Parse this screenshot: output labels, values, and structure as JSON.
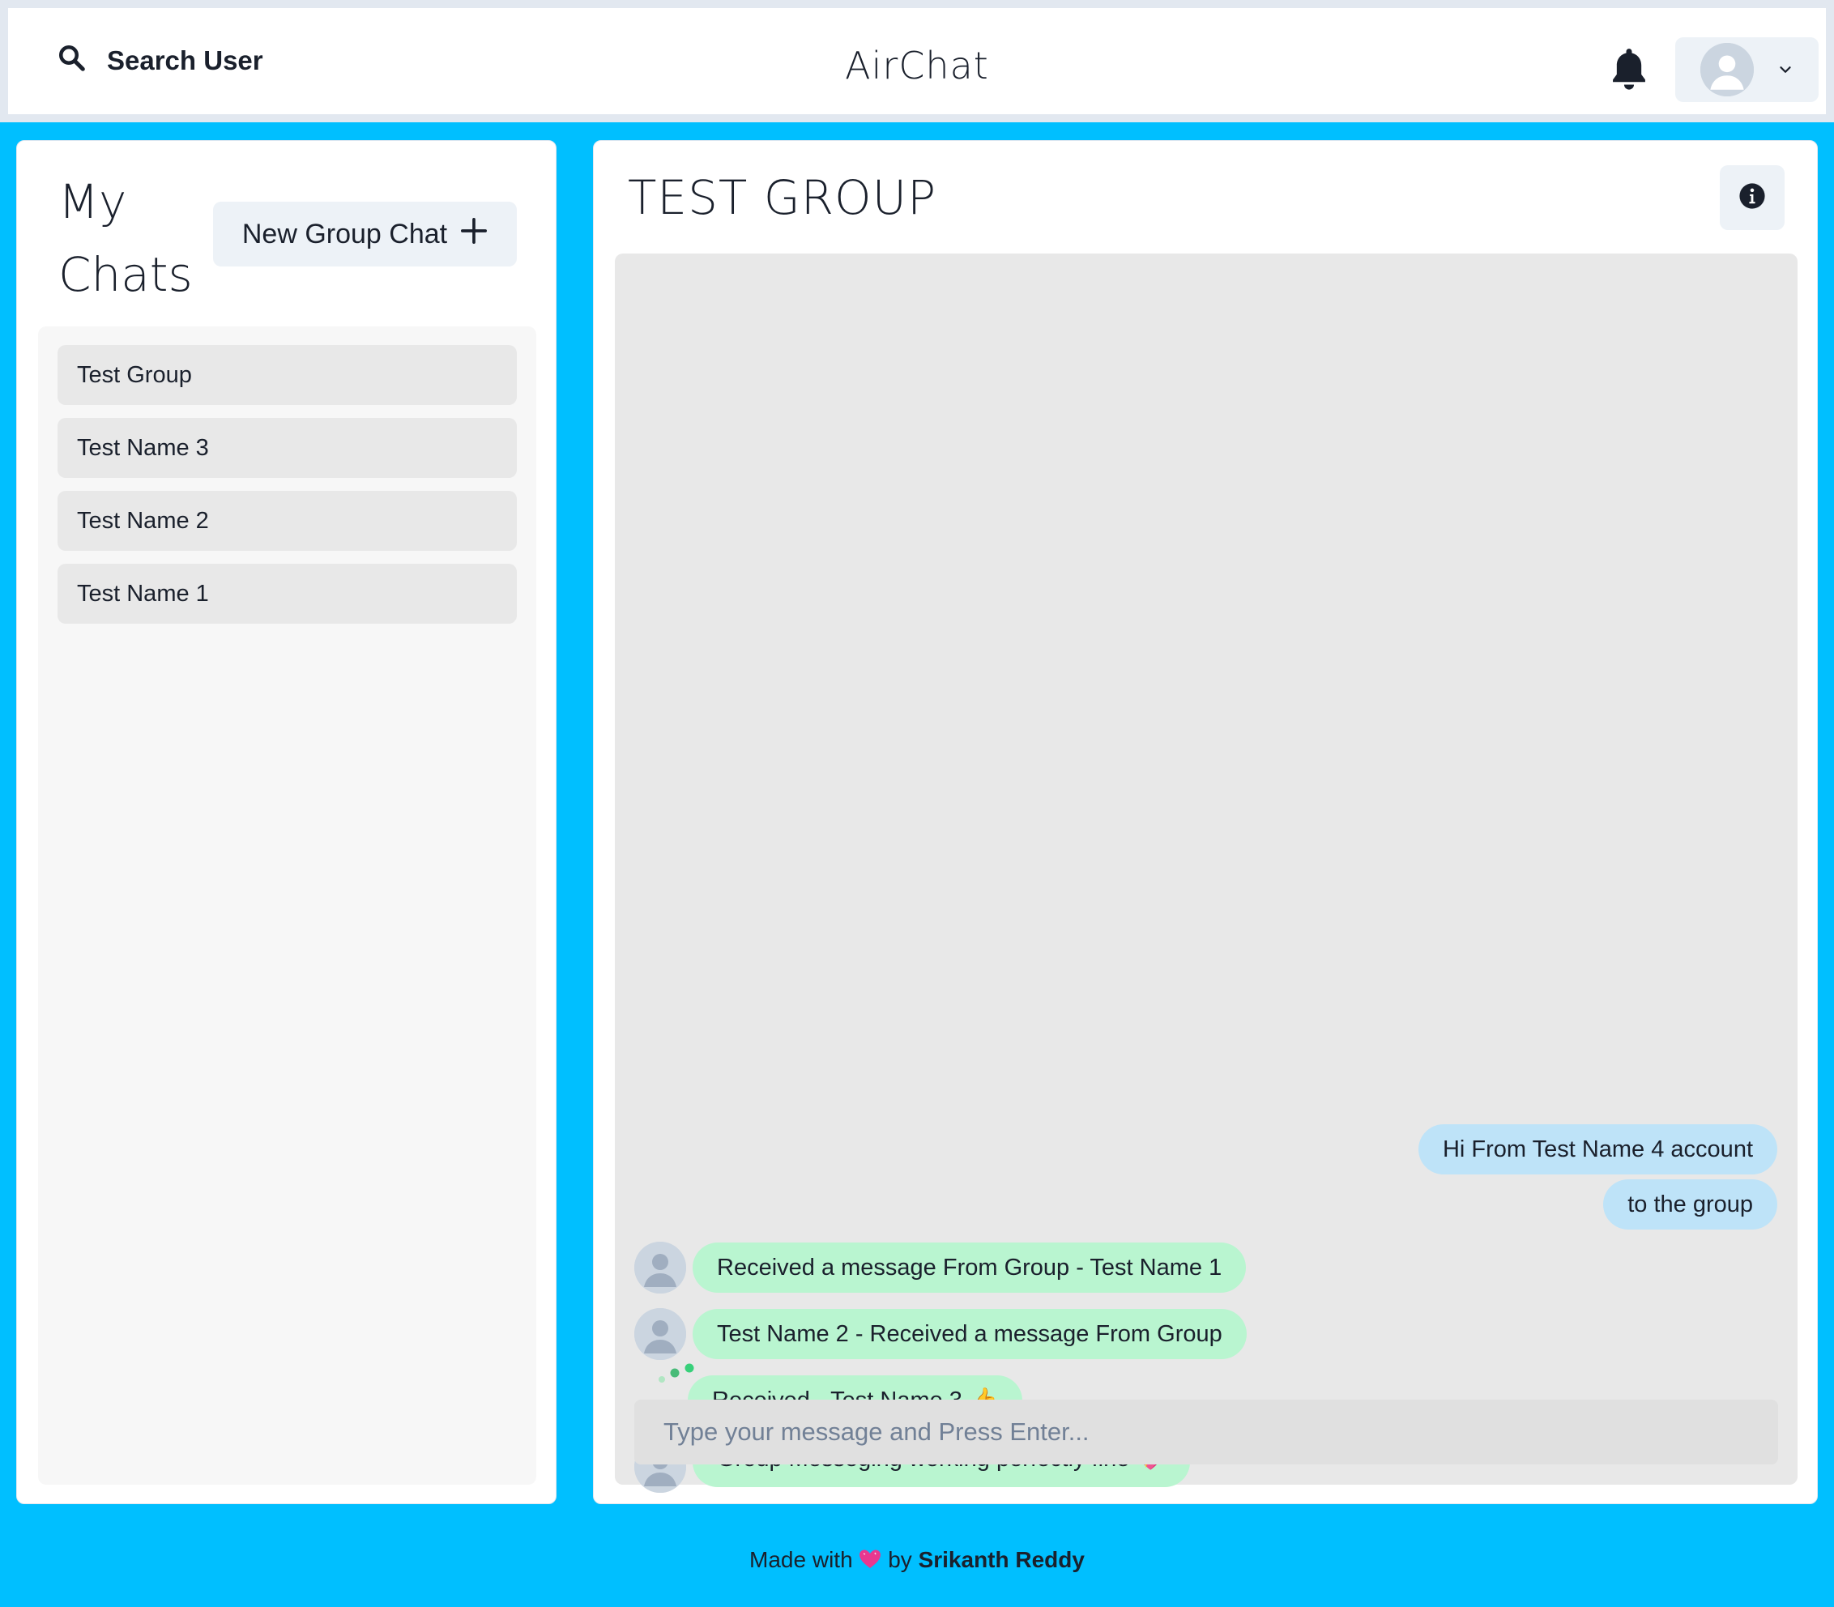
{
  "header": {
    "search_label": "Search User",
    "app_title": "AirChat",
    "bell_icon": "bell-icon",
    "profile_chevron": "chevron-down-icon"
  },
  "sidebar": {
    "title": "My Chats",
    "new_group_label": "New Group Chat",
    "chats": [
      {
        "name": "Test Group"
      },
      {
        "name": "Test Name 3"
      },
      {
        "name": "Test Name 2"
      },
      {
        "name": "Test Name 1"
      }
    ]
  },
  "chat": {
    "title": "TEST GROUP",
    "messages": [
      {
        "text": "Hi From Test Name 4 account",
        "side": "sent"
      },
      {
        "text": "to the group",
        "side": "sent"
      },
      {
        "text": "Received a message From Group - Test Name 1",
        "side": "received",
        "avatar": true
      },
      {
        "text": "Test Name 2 - Received a message From Group",
        "side": "received",
        "avatar": true
      },
      {
        "text": "Received - Test Name 3 👍",
        "side": "received",
        "avatar": false
      },
      {
        "text": "Group Messeging working perfectly fine 💖",
        "side": "received",
        "avatar": true
      }
    ],
    "input_placeholder": "Type your message and Press Enter..."
  },
  "footer": {
    "prefix": "Made with",
    "middle": "by",
    "author": "Srikanth Reddy"
  },
  "colors": {
    "background": "#00BFFF",
    "sent_bubble": "#BEE3F8",
    "received_bubble": "#B9F5D0",
    "heart": "#E8388F"
  }
}
